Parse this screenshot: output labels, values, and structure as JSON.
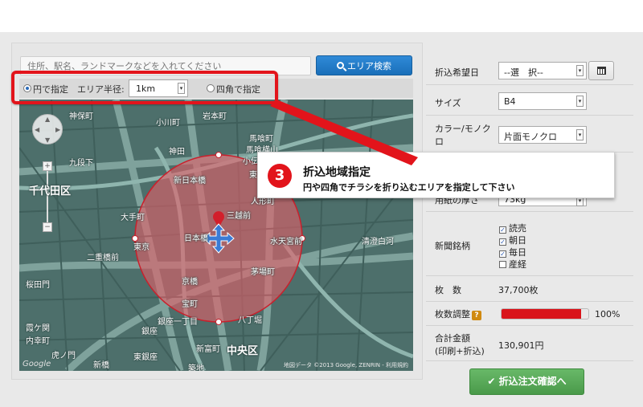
{
  "search": {
    "placeholder": "住所、駅名、ランドマークなどを入れてください",
    "button_label": "エリア検索"
  },
  "area_options": {
    "circle_label": "円で指定",
    "radius_label": "エリア半径:",
    "radius_value": "1km",
    "square_label": "四角で指定",
    "selected": "circle"
  },
  "map": {
    "labels": [
      "小川町",
      "岩本町",
      "神保町",
      "馬喰町",
      "神田",
      "馬喰横山",
      "小伝馬町",
      "九段下",
      "新日本橋",
      "東日本橋",
      "千代田区",
      "人形町",
      "三越前",
      "大手町",
      "日本橋",
      "水天宮前",
      "東京",
      "清澄白河",
      "二重橋前",
      "茅場町",
      "京橋",
      "桜田門",
      "宝町",
      "八丁堀",
      "霞ケ関",
      "銀座一丁目",
      "新富町",
      "中央区",
      "銀座",
      "東銀座",
      "内幸町",
      "虎ノ門",
      "新橋",
      "築地"
    ],
    "credit": "地図データ ©2013 Google, ZENRIN - 利用規約",
    "google_logo": "Google",
    "zoom_in": "+",
    "zoom_out": "−"
  },
  "callout": {
    "number": "3",
    "title": "折込地域指定",
    "description": "円や四角でチラシを折り込むエリアを指定して下さい"
  },
  "form": {
    "date_label": "折込希望日",
    "date_value": "--選　択--",
    "size_label": "サイズ",
    "size_value": "B4",
    "color_label": "カラー/モノクロ",
    "color_value": "片面モノクロ",
    "paper_label": "用紙の厚さ",
    "paper_value": "73kg",
    "newspaper_label": "新聞銘柄",
    "newspapers": [
      {
        "name": "読売",
        "checked": true
      },
      {
        "name": "朝日",
        "checked": true
      },
      {
        "name": "毎日",
        "checked": true
      },
      {
        "name": "産経",
        "checked": false
      }
    ],
    "count_label": "枚　数",
    "count_value": "37,700枚",
    "adjust_label": "枚数調整",
    "adjust_help": "?",
    "adjust_percent": 100,
    "adjust_text": "100%",
    "total_label": "合計金額",
    "total_sub": "(印刷+折込)",
    "total_value": "130,901円",
    "submit_label": "✔ 折込注文確認へ"
  },
  "colors": {
    "accent_red": "#e2141b",
    "primary_blue": "#1f78c8",
    "submit_green": "#57a857",
    "map_base": "#4d6f6b"
  }
}
